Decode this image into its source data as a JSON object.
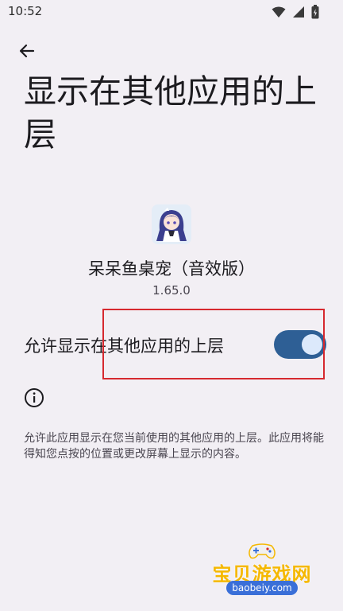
{
  "status_bar": {
    "time": "10:52",
    "icons": [
      "wifi-icon",
      "cellular-signal-icon",
      "battery-icon"
    ]
  },
  "header": {
    "back_icon": "arrow-back-icon",
    "title": "显示在其他应用的上层"
  },
  "app": {
    "icon": "anime-girl-app-icon",
    "name": "呆呆鱼桌宠（音效版）",
    "version": "1.65.0"
  },
  "permission": {
    "label": "允许显示在其他应用的上层",
    "enabled": true
  },
  "info": {
    "icon": "info-icon",
    "description": "允许此应用显示在您当前使用的其他应用的上层。此应用将能得知您点按的位置或更改屏幕上显示的内容。"
  },
  "watermark": {
    "title": "宝贝游戏网",
    "url": "baobeiy.com"
  },
  "colors": {
    "background": "#f2eff4",
    "switch_track": "#2e5f95",
    "switch_thumb": "#dce9fb",
    "highlight": "#d6292f"
  }
}
